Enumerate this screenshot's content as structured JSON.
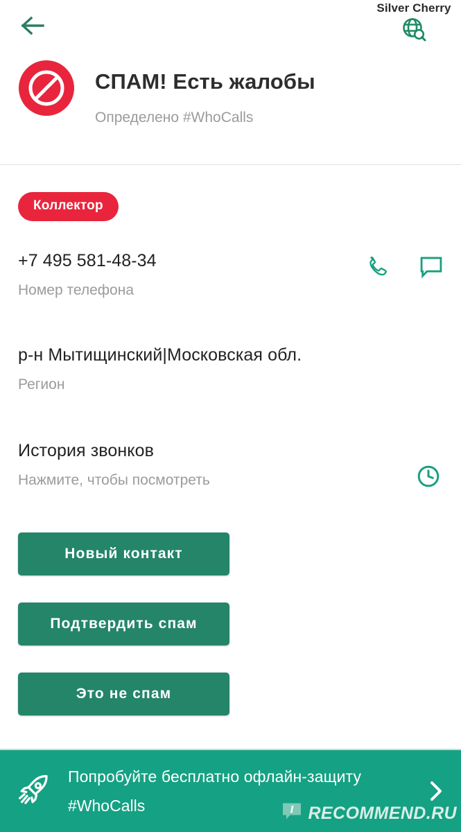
{
  "app": {
    "accent_teal": "#248569",
    "banner_teal": "#15a183",
    "spam_red": "#e8253c",
    "icon_teal": "#1aa07f",
    "muted_text": "#9b9b9b"
  },
  "topbar": {
    "back_label": "Назад",
    "watermark": "Silver Cherry",
    "globe_icon": "globe-search-icon"
  },
  "header": {
    "icon": "spam-block-icon",
    "title": "СПАМ! Есть жалобы",
    "subtitle": "Определено #WhoCalls"
  },
  "badge": {
    "label": "Коллектор"
  },
  "rows": [
    {
      "value": "+7 495 581-48-34",
      "label": "Номер телефона",
      "actions": [
        "call-icon",
        "message-icon"
      ]
    },
    {
      "value": "р-н Мытищинский|Московская обл.",
      "label": "Регион",
      "actions": []
    },
    {
      "value": "История звонков",
      "label": "Нажмите, чтобы посмотреть",
      "actions": [
        "clock-icon"
      ]
    }
  ],
  "buttons": [
    {
      "label": "Новый контакт",
      "name": "new-contact-button"
    },
    {
      "label": "Подтвердить спам",
      "name": "confirm-spam-button"
    },
    {
      "label": "Это не спам",
      "name": "not-spam-button"
    }
  ],
  "banner": {
    "icon": "rocket-icon",
    "line1": "Попробуйте бесплатно офлайн-защиту",
    "line2": "#WhoCalls",
    "chevron": "chevron-right-icon",
    "watermark_brand": "RECOMMEND.RU",
    "watermark_icon": "recommend-bubble-icon"
  }
}
